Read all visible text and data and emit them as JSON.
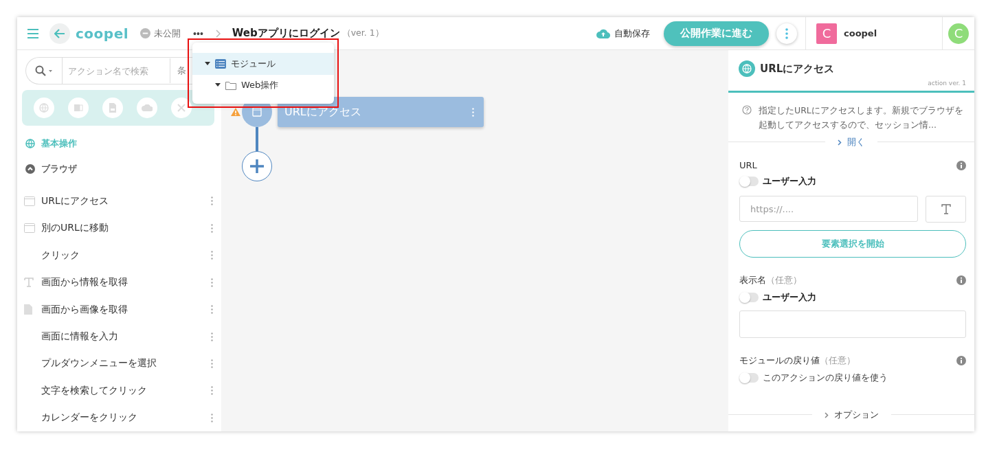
{
  "header": {
    "logo": "coopel",
    "status": "未公開",
    "more": "•••",
    "title": "Webアプリにログイン",
    "version": "（ver. 1）",
    "autosave": "自動保存",
    "publish_button": "公開作業に進む",
    "workspace": {
      "initial": "C",
      "name": "coopel",
      "color": "#f06b9c"
    },
    "user": {
      "initial": "C",
      "color": "#8fdc7a"
    }
  },
  "dropdown": {
    "items": [
      {
        "label": "モジュール",
        "kind": "module",
        "expanded": true,
        "selected": true,
        "children": [
          {
            "label": "Web操作",
            "kind": "folder",
            "expanded": true,
            "selected": false
          }
        ]
      }
    ]
  },
  "sidebar": {
    "search": {
      "placeholder": "アクション名で検索"
    },
    "filter": "条",
    "section": "基本操作",
    "group": {
      "label": "ブラウザ",
      "expanded": true
    },
    "items": [
      {
        "label": "URLにアクセス",
        "kind": "browser"
      },
      {
        "label": "別のURLに移動",
        "kind": "browser"
      },
      {
        "label": "クリック",
        "kind": "none"
      },
      {
        "label": "画面から情報を取得",
        "kind": "text"
      },
      {
        "label": "画面から画像を取得",
        "kind": "file"
      },
      {
        "label": "画面に情報を入力",
        "kind": "none"
      },
      {
        "label": "プルダウンメニューを選択",
        "kind": "none"
      },
      {
        "label": "文字を検索してクリック",
        "kind": "none"
      },
      {
        "label": "カレンダーをクリック",
        "kind": "none"
      }
    ]
  },
  "canvas": {
    "node": {
      "label": "URLにアクセス",
      "warning": true
    }
  },
  "panel": {
    "title": "URLにアクセス",
    "version": "action ver. 1",
    "description": "指定したURLにアクセスします。新規でブラウザを起動してアクセスするので、セッション情...",
    "open_link": "開く",
    "fields": [
      {
        "kind": "url",
        "label": "URL",
        "toggle": {
          "label": "ユーザー入力",
          "on": false
        },
        "placeholder": "https://....",
        "action_button": "要素選択を開始"
      },
      {
        "kind": "text",
        "label": "表示名",
        "optional": "（任意）",
        "toggle": {
          "label": "ユーザー入力",
          "on": false
        }
      },
      {
        "kind": "return",
        "label": "モジュールの戻り値",
        "optional": "（任意）",
        "toggle": {
          "label": "このアクションの戻り値を使う",
          "on": false
        }
      }
    ],
    "options": "オプション"
  }
}
